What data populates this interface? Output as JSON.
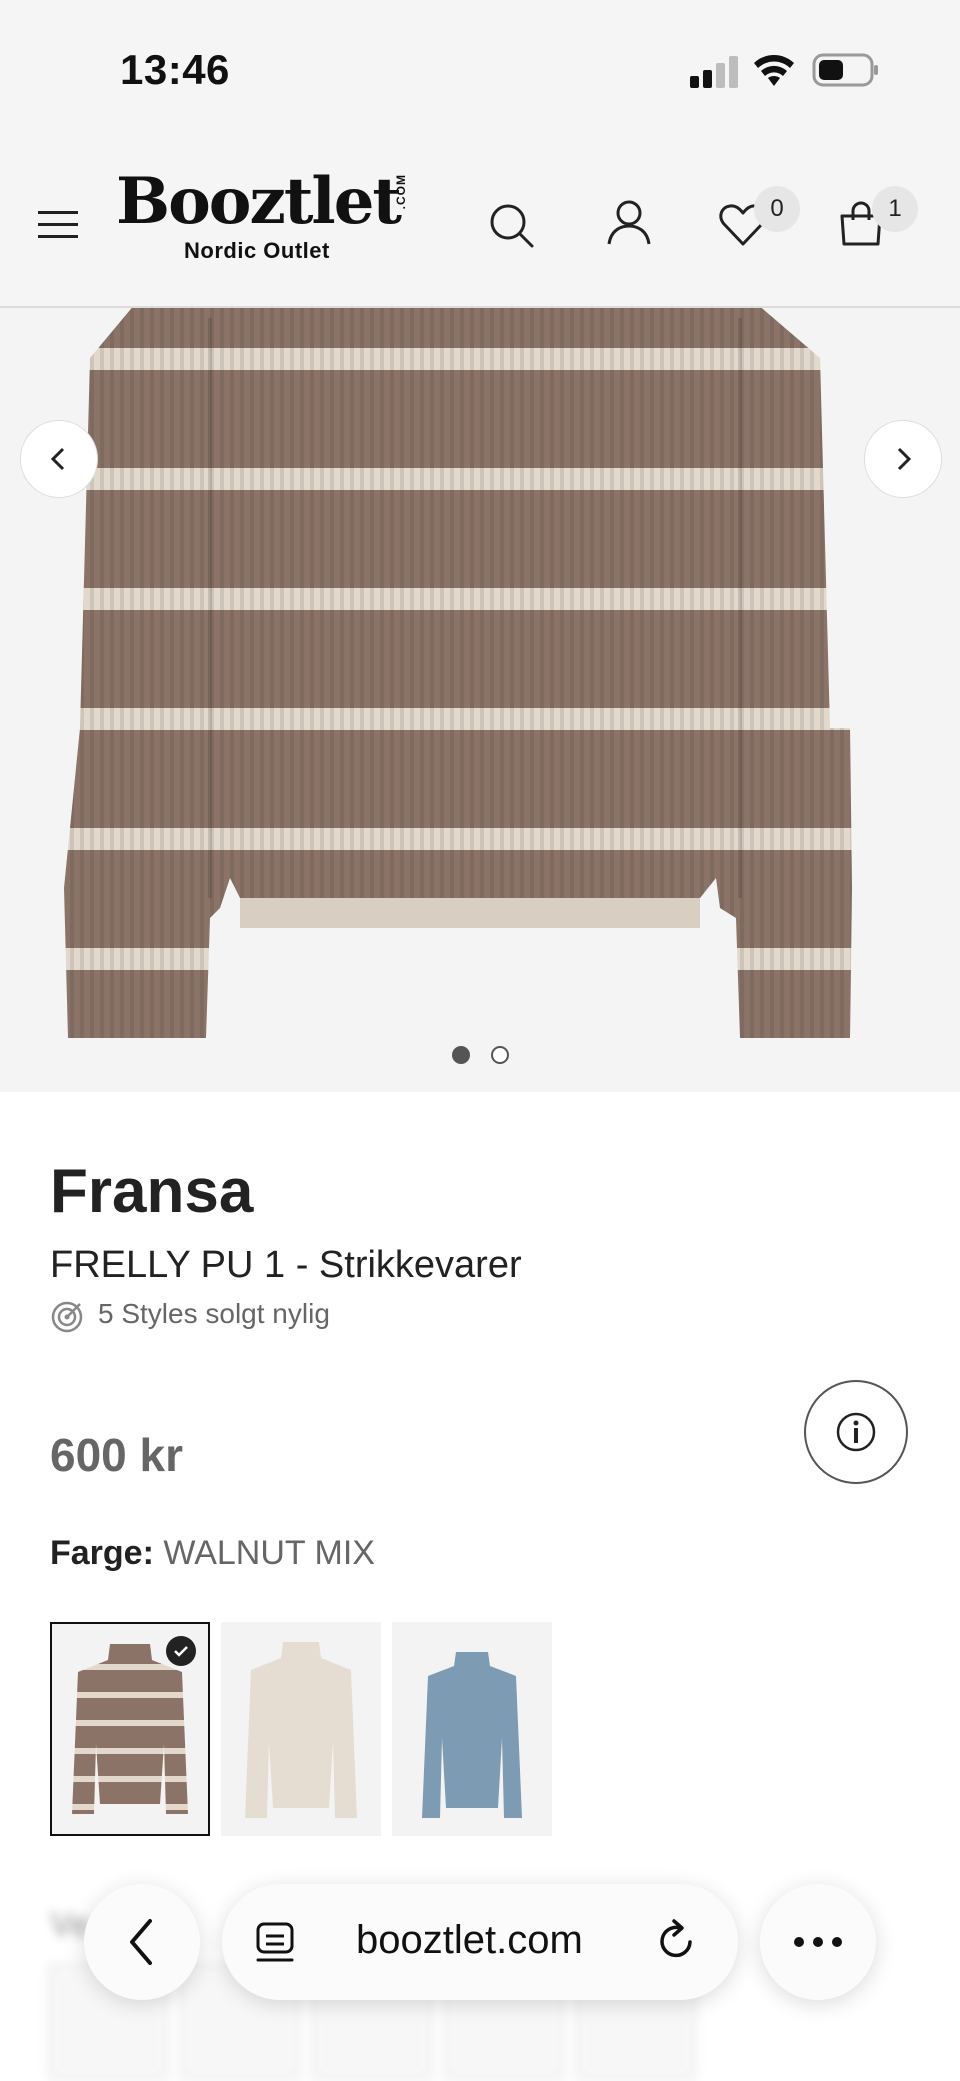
{
  "status_bar": {
    "time": "13:46"
  },
  "header": {
    "logo_word": "Booztlet",
    "logo_com": ".COM",
    "logo_sub": "Nordic Outlet",
    "wishlist_count": "0",
    "cart_count": "1"
  },
  "gallery": {
    "image_count": 2,
    "active_index": 0
  },
  "product": {
    "brand": "Fransa",
    "name": "FRELLY PU 1 - Strikkevarer",
    "sold_text": "5 Styles solgt nylig",
    "price": "600 kr",
    "color_label": "Farge:",
    "color_value": "WALNUT MIX",
    "swatches": [
      {
        "color": "walnut-stripe",
        "selected": true
      },
      {
        "color": "cream",
        "selected": false
      },
      {
        "color": "blue",
        "selected": false
      }
    ]
  },
  "blurred_section": {
    "title": "Ve          re"
  },
  "browser": {
    "url": "booztlet.com"
  },
  "colors": {
    "background": "#f5f5f5",
    "text": "#1c1c1c",
    "muted": "#666666",
    "sweater_brown": "#8b7467",
    "sweater_cream": "#e2d8cc"
  }
}
